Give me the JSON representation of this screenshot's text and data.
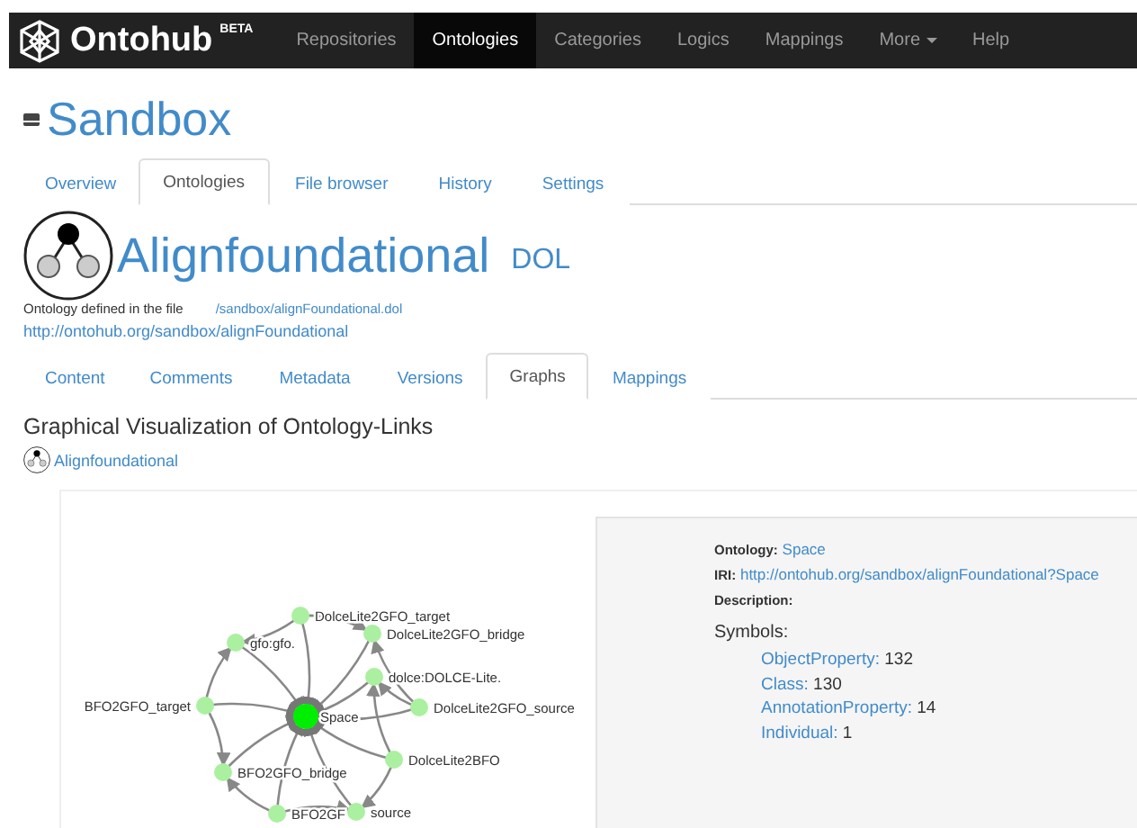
{
  "navbar": {
    "brand": "Ontohub",
    "badge": "BETA",
    "items": [
      {
        "label": "Repositories",
        "selected": false
      },
      {
        "label": "Ontologies",
        "selected": true
      },
      {
        "label": "Categories",
        "selected": false
      },
      {
        "label": "Logics",
        "selected": false
      },
      {
        "label": "Mappings",
        "selected": false
      },
      {
        "label": "More",
        "selected": false,
        "dropdown": true
      },
      {
        "label": "Help",
        "selected": false
      }
    ]
  },
  "repository": {
    "title": "Sandbox",
    "tabs": [
      {
        "label": "Overview",
        "selected": false
      },
      {
        "label": "Ontologies",
        "selected": true
      },
      {
        "label": "File browser",
        "selected": false
      },
      {
        "label": "History",
        "selected": false
      },
      {
        "label": "Settings",
        "selected": false
      }
    ]
  },
  "ontology": {
    "title": "Alignfoundational",
    "language": "DOL",
    "defined_label": "Ontology defined in the file",
    "file": "/sandbox/alignFoundational.dol",
    "iri": "http://ontohub.org/sandbox/alignFoundational",
    "tabs": [
      {
        "label": "Content",
        "selected": false
      },
      {
        "label": "Comments",
        "selected": false
      },
      {
        "label": "Metadata",
        "selected": false
      },
      {
        "label": "Versions",
        "selected": false
      },
      {
        "label": "Graphs",
        "selected": true
      },
      {
        "label": "Mappings",
        "selected": false
      }
    ]
  },
  "graphs": {
    "heading": "Graphical Visualization of Ontology-Links",
    "root_link": "Alignfoundational",
    "nodes": [
      {
        "label": "DolceLite2GFO_target",
        "selected": false
      },
      {
        "label": "DolceLite2GFO_bridge",
        "selected": false
      },
      {
        "label": "gfo:gfo.",
        "selected": false
      },
      {
        "label": "dolce:DOLCE-Lite.",
        "selected": false
      },
      {
        "label": "BFO2GFO_target",
        "selected": false
      },
      {
        "label": "DolceLite2GFO_source",
        "selected": false
      },
      {
        "label": "Space",
        "selected": true
      },
      {
        "label": "DolceLite2BFO",
        "selected": false
      },
      {
        "label": "BFO2GFO_bridge",
        "selected": false
      },
      {
        "label": "BFO2GF",
        "selected": false
      },
      {
        "label": "source",
        "selected": false
      }
    ],
    "info": {
      "ontology_label": "Ontology:",
      "ontology": "Space",
      "iri_label": "IRI:",
      "iri": "http://ontohub.org/sandbox/alignFoundational?Space",
      "description_label": "Description:",
      "symbols_label": "Symbols:",
      "symbols": [
        {
          "name": "ObjectProperty:",
          "count": "132"
        },
        {
          "name": "Class:",
          "count": "130"
        },
        {
          "name": "AnnotationProperty:",
          "count": "14"
        },
        {
          "name": "Individual:",
          "count": "1"
        }
      ]
    }
  }
}
